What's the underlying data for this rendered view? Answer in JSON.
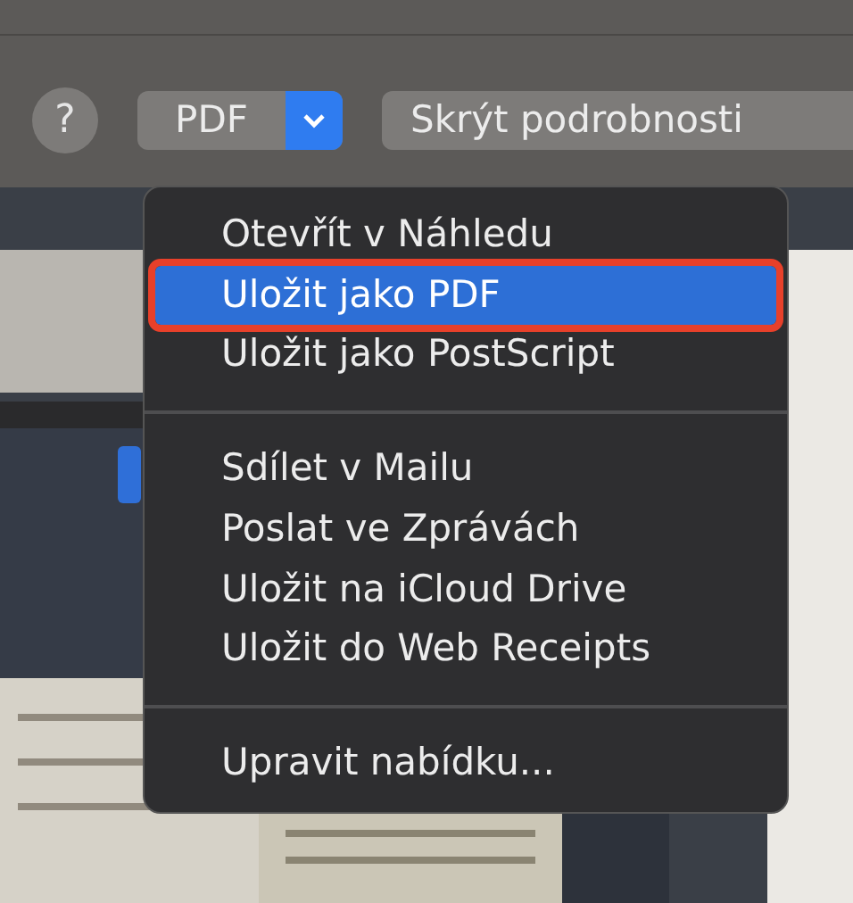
{
  "toolbar": {
    "help_button": "?",
    "format_button": "PDF",
    "details_button": "Skrýt podrobnosti"
  },
  "menu": {
    "items": [
      {
        "kind": "item",
        "label": "Otevřít v Náhledu",
        "selected": false
      },
      {
        "kind": "item",
        "label": "Uložit jako PDF",
        "selected": true
      },
      {
        "kind": "item",
        "label": "Uložit jako PostScript",
        "selected": false
      },
      {
        "kind": "separator"
      },
      {
        "kind": "item",
        "label": "Sdílet v Mailu",
        "selected": false
      },
      {
        "kind": "item",
        "label": "Poslat ve Zprávách",
        "selected": false
      },
      {
        "kind": "item",
        "label": "Uložit na iCloud Drive",
        "selected": false
      },
      {
        "kind": "item",
        "label": "Uložit do Web Receipts",
        "selected": false
      },
      {
        "kind": "separator"
      },
      {
        "kind": "item",
        "label": "Upravit nabídku...",
        "selected": false
      }
    ]
  }
}
